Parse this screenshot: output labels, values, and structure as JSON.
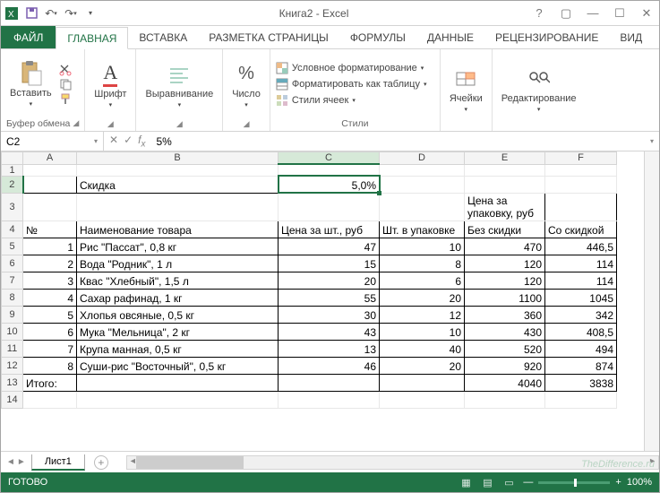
{
  "title": "Книга2 - Excel",
  "tabs": {
    "file": "ФАЙЛ",
    "home": "ГЛАВНАЯ",
    "insert": "ВСТАВКА",
    "page": "РАЗМЕТКА СТРАНИЦЫ",
    "formulas": "ФОРМУЛЫ",
    "data": "ДАННЫЕ",
    "review": "РЕЦЕНЗИРОВАНИЕ",
    "view": "ВИД"
  },
  "ribbon": {
    "clipboard": {
      "paste": "Вставить",
      "label": "Буфер обмена"
    },
    "font": {
      "label": "Шрифт"
    },
    "align": {
      "label": "Выравнивание"
    },
    "number": {
      "label": "Число"
    },
    "styles": {
      "cond": "Условное форматирование",
      "table": "Форматировать как таблицу",
      "cell": "Стили ячеек",
      "label": "Стили"
    },
    "cells": {
      "label": "Ячейки"
    },
    "editing": {
      "label": "Редактирование"
    }
  },
  "namebox": "C2",
  "formula": "5%",
  "columns": [
    "A",
    "B",
    "C",
    "D",
    "E",
    "F"
  ],
  "rows": [
    "1",
    "2",
    "3",
    "4",
    "5",
    "6",
    "7",
    "8",
    "9",
    "10",
    "11",
    "12",
    "13",
    "14"
  ],
  "cells": {
    "B2": "Скидка",
    "C2": "5,0%",
    "E3": "Цена за упаковку, руб",
    "A4": "№",
    "B4": "Наименование товара",
    "C4": "Цена за шт., руб",
    "D4": "Шт. в упаковке",
    "E4": "Без скидки",
    "F4": "Со скидкой",
    "A5": "1",
    "B5": "Рис \"Пассат\", 0,8 кг",
    "C5": "47",
    "D5": "10",
    "E5": "470",
    "F5": "446,5",
    "A6": "2",
    "B6": "Вода \"Родник\", 1 л",
    "C6": "15",
    "D6": "8",
    "E6": "120",
    "F6": "114",
    "A7": "3",
    "B7": "Квас \"Хлебный\", 1,5 л",
    "C7": "20",
    "D7": "6",
    "E7": "120",
    "F7": "114",
    "A8": "4",
    "B8": "Сахар рафинад, 1 кг",
    "C8": "55",
    "D8": "20",
    "E8": "1100",
    "F8": "1045",
    "A9": "5",
    "B9": "Хлопья овсяные, 0,5 кг",
    "C9": "30",
    "D9": "12",
    "E9": "360",
    "F9": "342",
    "A10": "6",
    "B10": "Мука \"Мельница\", 2 кг",
    "C10": "43",
    "D10": "10",
    "E10": "430",
    "F10": "408,5",
    "A11": "7",
    "B11": "Крупа манная, 0,5 кг",
    "C11": "13",
    "D11": "40",
    "E11": "520",
    "F11": "494",
    "A12": "8",
    "B12": "Суши-рис \"Восточный\", 0,5 кг",
    "C12": "46",
    "D12": "20",
    "E12": "920",
    "F12": "874",
    "A13": "Итого:",
    "E13": "4040",
    "F13": "3838"
  },
  "sheet_tab": "Лист1",
  "status": "ГОТОВО",
  "zoom": "100%",
  "watermark": "TheDifference.ru"
}
